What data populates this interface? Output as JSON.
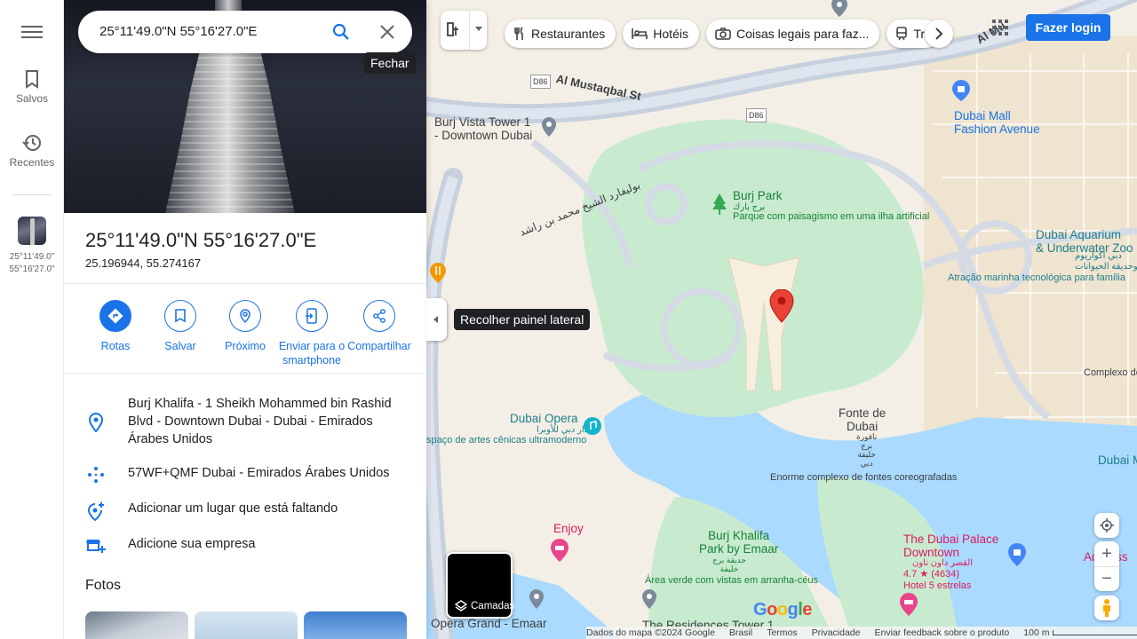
{
  "rail": {
    "saved_label": "Salvos",
    "recents_label": "Recentes",
    "recent_item_line1": "25°11'49.0\"",
    "recent_item_line2": "55°16'27.0\""
  },
  "search": {
    "query": "25°11'49.0\"N 55°16'27.0\"E",
    "close_tooltip": "Fechar"
  },
  "place": {
    "title": "25°11'49.0\"N 55°16'27.0\"E",
    "decimal_coords": "25.196944, 55.274167"
  },
  "actions": [
    {
      "label": "Rotas"
    },
    {
      "label": "Salvar"
    },
    {
      "label": "Próximo"
    },
    {
      "label": "Enviar para o smartphone"
    },
    {
      "label": "Compartilhar"
    }
  ],
  "details": {
    "address": "Burj Khalifa - 1 Sheikh Mohammed bin Rashid Blvd - Downtown Dubai - Dubai - Emirados Árabes Unidos",
    "plus_code": "57WF+QMF Dubai - Emirados Árabes Unidos",
    "add_place": "Adicionar um lugar que está faltando",
    "add_business": "Adicione sua empresa"
  },
  "photos_heading": "Fotos",
  "map": {
    "chips": [
      "Restaurantes",
      "Hotéis",
      "Coisas legais para faz...",
      "Tran"
    ],
    "login_label": "Fazer login",
    "collapse_tooltip": "Recolher painel lateral",
    "layers_label": "Camadas",
    "labels": {
      "al_mustaqbal": "Al Mustaqbal St",
      "al_mustaqbal_2": "Al Mu",
      "d86_a": "D86",
      "d86_b": "D86",
      "burj_vista": "Burj Vista Tower 1\n- Downtown Dubai",
      "dubai_mall": "Dubai Mall\nFashion Avenue",
      "burj_park": "Burj Park",
      "burj_park_ar": "برج بارك",
      "burj_park_desc": "Parque com paisagismo em uma ilha artificial",
      "arabic_road": "بوليفارد الشيخ محمد بن راشد",
      "aquarium": "Dubai Aquarium\n& Underwater Zoo",
      "aquarium_ar": "دبي أكواريوم\nوحديقة الحيوانات",
      "aquarium_desc": "Atração marinha tecnológica para família",
      "complexo": "Complexo de",
      "dubai_opera": "Dubai Opera",
      "dubai_opera_ar": "دار دبي للأوبرا",
      "opera_desc": "spaço de artes cênicas ultramoderno",
      "fonte": "Fonte de\nDubai",
      "fonte_ar": "نافورة\nبرج\nخليفة\nدبي",
      "fonte_desc": "Enorme complexo de fontes coreografadas",
      "dubai_m": "Dubai M",
      "enjoy": "Enjoy",
      "khalifa_park": "Burj Khalifa\nPark by Emaar",
      "khalifa_park_ar": "حديقة برج\nخليفة",
      "khalifa_park_desc": "Área verde com vistas em arranha-céus",
      "palace": "The Dubai Palace\nDowntown",
      "palace_ar": "القصر داون تاون",
      "palace_rating": "4.7 ★ (4634)",
      "palace_desc": "Hotel 5 estrelas",
      "address_r": "Address",
      "opera_grand": "Opera Grand - Emaar",
      "residences": "The Residences Tower 1"
    },
    "footer": {
      "data": "Dados do mapa ©2024 Google",
      "country": "Brasil",
      "terms": "Termos",
      "privacy": "Privacidade",
      "feedback": "Enviar feedback sobre o produto",
      "scale": "100 m"
    },
    "logo_text": "Google",
    "colors": {
      "accent": "#1a73e8",
      "pin": "#ea4335",
      "park": "#c8ebd0",
      "water": "#aadaff"
    }
  }
}
